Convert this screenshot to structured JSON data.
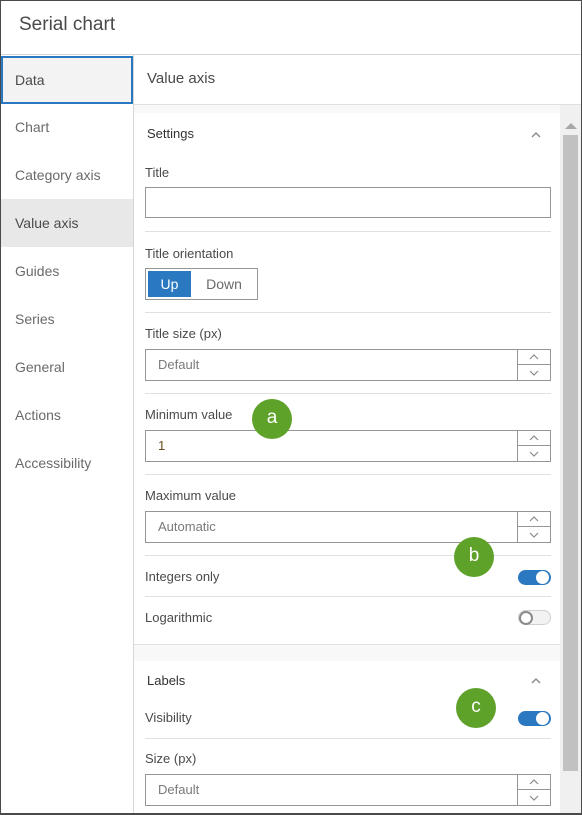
{
  "window": {
    "title": "Serial chart"
  },
  "sidebar": {
    "items": [
      {
        "label": "Data",
        "state": "focused"
      },
      {
        "label": "Chart",
        "state": "normal"
      },
      {
        "label": "Category axis",
        "state": "normal"
      },
      {
        "label": "Value axis",
        "state": "active"
      },
      {
        "label": "Guides",
        "state": "normal"
      },
      {
        "label": "Series",
        "state": "normal"
      },
      {
        "label": "General",
        "state": "normal"
      },
      {
        "label": "Actions",
        "state": "normal"
      },
      {
        "label": "Accessibility",
        "state": "normal"
      }
    ]
  },
  "main": {
    "title": "Value axis",
    "settings": {
      "section_title": "Settings",
      "title_label": "Title",
      "title_value": "",
      "orientation_label": "Title orientation",
      "orientation_options": [
        "Up",
        "Down"
      ],
      "orientation_selected": "Up",
      "title_size_label": "Title size (px)",
      "title_size_placeholder": "Default",
      "min_label": "Minimum value",
      "min_value": "1",
      "max_label": "Maximum value",
      "max_placeholder": "Automatic",
      "integers_label": "Integers only",
      "integers_on": true,
      "log_label": "Logarithmic",
      "log_on": false
    },
    "labels": {
      "section_title": "Labels",
      "visibility_label": "Visibility",
      "visibility_on": true,
      "size_label": "Size (px)",
      "size_placeholder": "Default"
    }
  },
  "callouts": [
    "a",
    "b",
    "c"
  ],
  "colors": {
    "accent": "#2a79c0",
    "callout": "#5ea22a"
  }
}
